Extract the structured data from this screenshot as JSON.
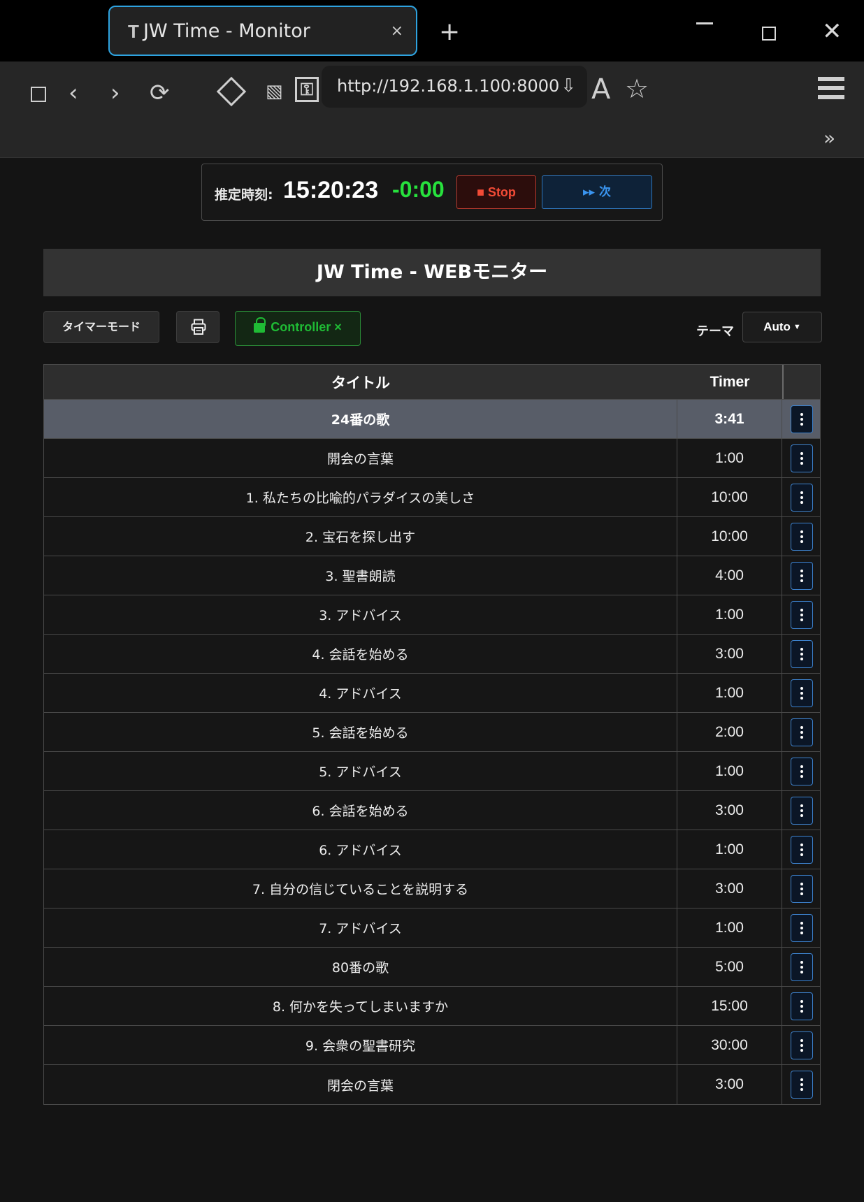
{
  "browser": {
    "tab_favicon": "T",
    "tab_title": "JW Time - Monitor",
    "tab_close": "×",
    "new_tab": "+",
    "win_close": "✕",
    "url": "http://192.168.1.100:8000",
    "icons": [
      "sidebar-icon",
      "back-icon",
      "forward-icon",
      "reload-icon",
      "diamond-icon",
      "reader-icon",
      "key-icon",
      "download-icon",
      "font-icon",
      "star-icon",
      "menu-icon",
      "more-icon"
    ]
  },
  "status": {
    "label": "推定時刻:",
    "clock": "15:20:23",
    "diff": "-0:00",
    "stop_label": "■ Stop",
    "next_label": "▸▸ 次"
  },
  "page": {
    "title": "JW Time - WEBモニター"
  },
  "controls": {
    "timer_mode": "タイマーモード",
    "controller": "Controller ×",
    "theme_label": "テーマ",
    "theme_value": "Auto"
  },
  "table": {
    "headers": {
      "title": "タイトル",
      "timer": "Timer"
    },
    "rows": [
      {
        "title": "24番の歌",
        "timer": "3:41",
        "current": true
      },
      {
        "title": "開会の言葉",
        "timer": "1:00"
      },
      {
        "title": "1. 私たちの比喩的パラダイスの美しさ",
        "timer": "10:00"
      },
      {
        "title": "2. 宝石を探し出す",
        "timer": "10:00"
      },
      {
        "title": "3. 聖書朗読",
        "timer": "4:00"
      },
      {
        "title": "3. アドバイス",
        "timer": "1:00"
      },
      {
        "title": "4. 会話を始める",
        "timer": "3:00"
      },
      {
        "title": "4. アドバイス",
        "timer": "1:00"
      },
      {
        "title": "5. 会話を始める",
        "timer": "2:00"
      },
      {
        "title": "5. アドバイス",
        "timer": "1:00"
      },
      {
        "title": "6. 会話を始める",
        "timer": "3:00"
      },
      {
        "title": "6. アドバイス",
        "timer": "1:00"
      },
      {
        "title": "7. 自分の信じていることを説明する",
        "timer": "3:00"
      },
      {
        "title": "7. アドバイス",
        "timer": "1:00"
      },
      {
        "title": "80番の歌",
        "timer": "5:00"
      },
      {
        "title": "8. 何かを失ってしまいますか",
        "timer": "15:00"
      },
      {
        "title": "9. 会衆の聖書研究",
        "timer": "30:00"
      },
      {
        "title": "閉会の言葉",
        "timer": "3:00"
      }
    ]
  },
  "colors": {
    "diff_green": "#27e13d",
    "stop_red": "#f24b36",
    "next_blue": "#3a95f0",
    "controller_green": "#1fbb35",
    "current_row": "#585d68",
    "tab_outline": "#2ea3e0"
  }
}
